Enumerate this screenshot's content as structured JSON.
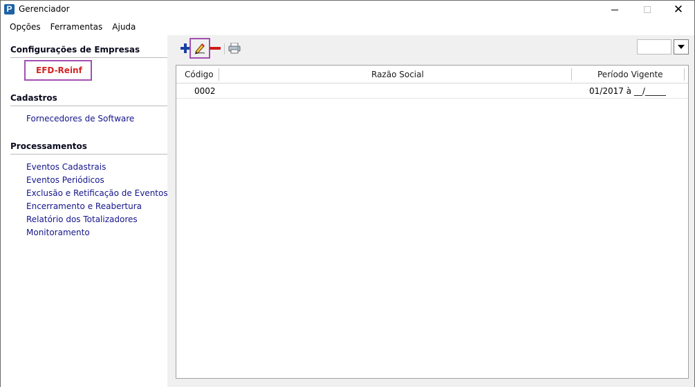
{
  "window": {
    "title": "Gerenciador",
    "app_icon_letter": "P"
  },
  "menu": {
    "items": [
      "Opções",
      "Ferramentas",
      "Ajuda"
    ]
  },
  "sidebar": {
    "sections": [
      {
        "title": "Configurações de Empresas",
        "items": [
          "EFD-Reinf"
        ]
      },
      {
        "title": "Cadastros",
        "items": [
          "Fornecedores de Software"
        ]
      },
      {
        "title": "Processamentos",
        "items": [
          "Eventos Cadastrais",
          "Eventos Periódicos",
          "Exclusão e Retificação de Eventos",
          "Encerramento e Reabertura",
          "Relatório dos Totalizadores",
          "Monitoramento"
        ]
      }
    ],
    "active_item": "EFD-Reinf"
  },
  "toolbar": {
    "icons": [
      "add-icon",
      "edit-icon",
      "remove-icon",
      "print-icon"
    ],
    "combo_value": ""
  },
  "grid": {
    "columns": [
      "Código",
      "Razão Social",
      "Período Vigente"
    ],
    "rows": [
      [
        "0002",
        "",
        "01/2017 à __/_____"
      ]
    ]
  },
  "colors": {
    "link": "#14148c",
    "active": "#d42424",
    "highlight_border": "#a24fb2",
    "add": "#1a3fa8",
    "remove": "#d01818"
  }
}
